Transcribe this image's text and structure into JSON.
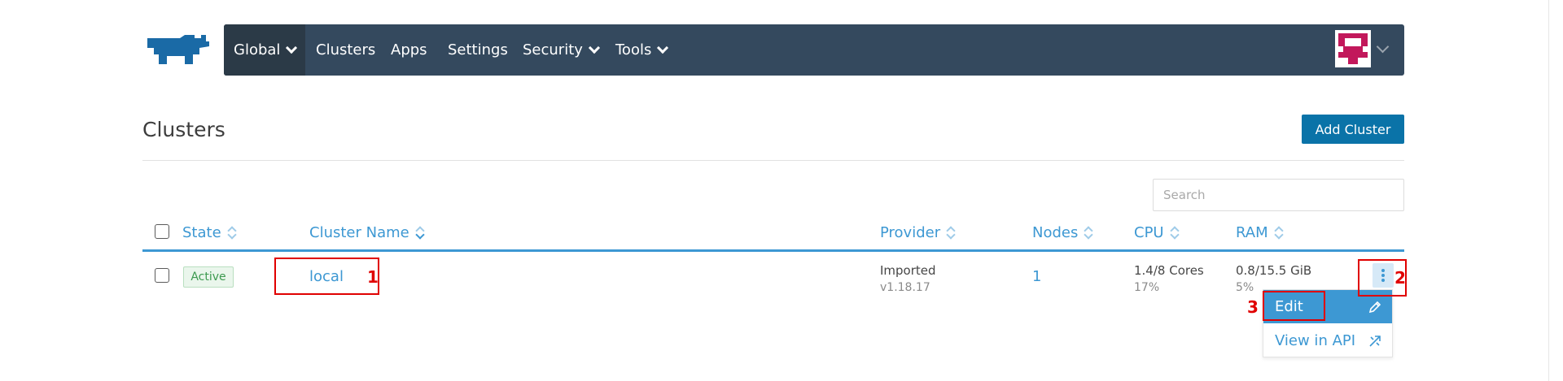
{
  "nav": {
    "global": "Global",
    "items": [
      "Clusters",
      "Apps",
      "Settings",
      "Security",
      "Tools"
    ]
  },
  "page": {
    "title": "Clusters",
    "add_button": "Add Cluster",
    "search_placeholder": "Search"
  },
  "table": {
    "columns": [
      "State",
      "Cluster Name",
      "Provider",
      "Nodes",
      "CPU",
      "RAM"
    ],
    "rows": [
      {
        "state": "Active",
        "name": "local",
        "provider": "Imported",
        "provider_version": "v1.18.17",
        "nodes": "1",
        "cpu": "1.4/8 Cores",
        "cpu_pct": "17%",
        "ram": "0.8/15.5 GiB",
        "ram_pct": "5%"
      }
    ]
  },
  "menu": {
    "edit": "Edit",
    "view_api": "View in API"
  },
  "annotations": [
    "1",
    "2",
    "3"
  ],
  "colors": {
    "navbar": "#34495e",
    "accent": "#3d98d3",
    "primary_button": "#0a73a8",
    "active_green": "#3c9a4f",
    "annotation_red": "#e00000"
  }
}
